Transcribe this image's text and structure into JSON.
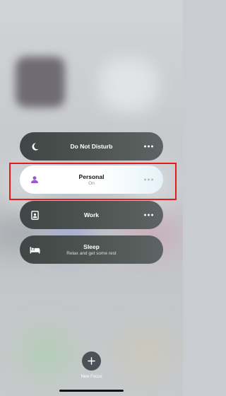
{
  "focus_modes": [
    {
      "label": "Do Not Disturb",
      "subtitle": "",
      "icon": "moon-icon"
    },
    {
      "label": "Personal",
      "subtitle": "On",
      "icon": "person-icon",
      "active": true
    },
    {
      "label": "Work",
      "subtitle": "",
      "icon": "id-badge-icon"
    },
    {
      "label": "Sleep",
      "subtitle": "Relax and get some rest",
      "icon": "bed-icon"
    }
  ],
  "new_focus": {
    "label": "New Focus",
    "icon": "plus-icon"
  },
  "colors": {
    "personal_accent": "#9b59d6",
    "highlight": "#e01b1b"
  }
}
